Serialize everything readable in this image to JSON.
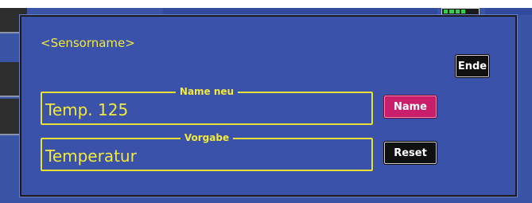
{
  "dialog": {
    "title": "<Sensorname>",
    "close_label": "Ende"
  },
  "fields": {
    "name_new": {
      "legend": "Name neu",
      "value": "Temp. 125",
      "action_label": "Name"
    },
    "default": {
      "legend": "Vorgabe",
      "value": "Temperatur",
      "action_label": "Reset"
    }
  },
  "colors": {
    "background": "#3a52aa",
    "text_accent": "#f3e93b",
    "primary_button": "#c81e6b",
    "secondary_button": "#101010",
    "battery_level": "#34d04a"
  },
  "status": {
    "battery_level_fraction": 0.5
  }
}
